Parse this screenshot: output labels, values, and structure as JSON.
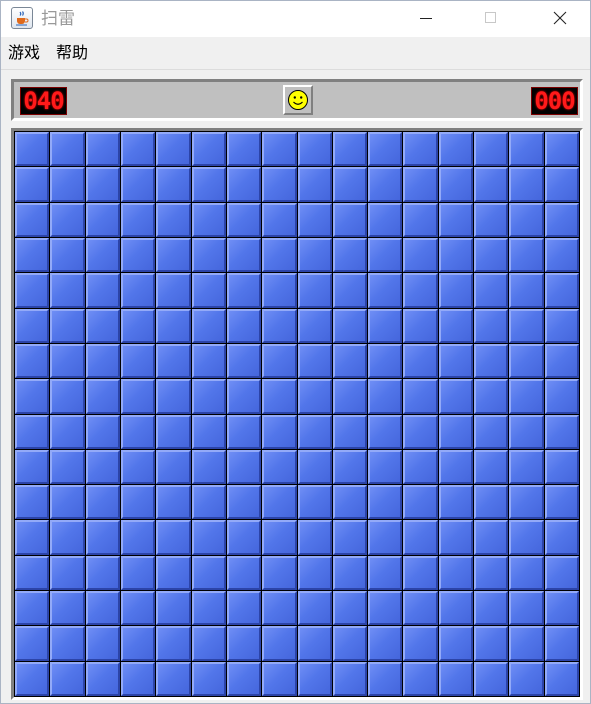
{
  "window": {
    "title": "扫雷",
    "icon": "java-cup-icon"
  },
  "menu": {
    "game_label": "游戏",
    "help_label": "帮助"
  },
  "status": {
    "mines_remaining": "040",
    "elapsed_time": "000",
    "face": "smiley-face-icon"
  },
  "board": {
    "rows": 16,
    "columns": 16,
    "cell_state": "unrevealed",
    "cell_color": "#5276ea"
  },
  "colors": {
    "lcd_digits": "#ff1a1a",
    "lcd_background": "#000000",
    "panel": "#c0c0c0",
    "face": "#ffff00"
  }
}
